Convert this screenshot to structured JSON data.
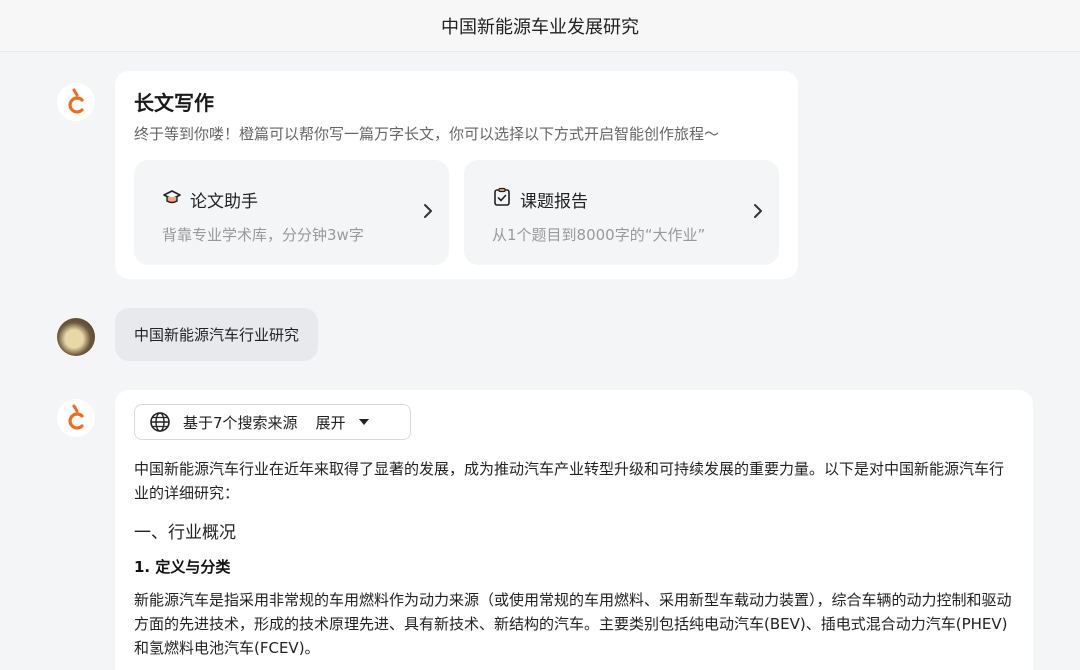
{
  "header": {
    "title": "中国新能源车业发展研究"
  },
  "welcome": {
    "heading": "长文写作",
    "subtitle": "终于等到你喽！橙篇可以帮你写一篇万字长文，你可以选择以下方式开启智能创作旅程～",
    "options": [
      {
        "title": "论文助手",
        "desc": "背靠专业学术库，分分钟3w字",
        "icon": "graduation-cap-icon"
      },
      {
        "title": "课题报告",
        "desc": "从1个题目到8000字的“大作业”",
        "icon": "clipboard-check-icon"
      }
    ]
  },
  "user_message": {
    "text": "中国新能源汽车行业研究"
  },
  "answer": {
    "sources_label": "基于7个搜索来源",
    "expand_label": "展开",
    "intro": "中国新能源汽车行业在近年来取得了显著的发展，成为推动汽车产业转型升级和可持续发展的重要力量。以下是对中国新能源汽车行业的详细研究：",
    "section_heading": "一、行业概况",
    "subsection_heading": "1. 定义与分类",
    "body": "新能源汽车是指采用非常规的车用燃料作为动力来源（或使用常规的车用燃料、采用新型车载动力装置），综合车辆的动力控制和驱动方面的先进技术，形成的技术原理先进、具有新技术、新结构的汽车。主要类别包括纯电动汽车(BEV)、插电式混合动力汽车(PHEV)和氢燃料电池汽车(FCEV)。"
  },
  "colors": {
    "brand_orange": "#f26b1d",
    "background": "#f4f5f7"
  }
}
